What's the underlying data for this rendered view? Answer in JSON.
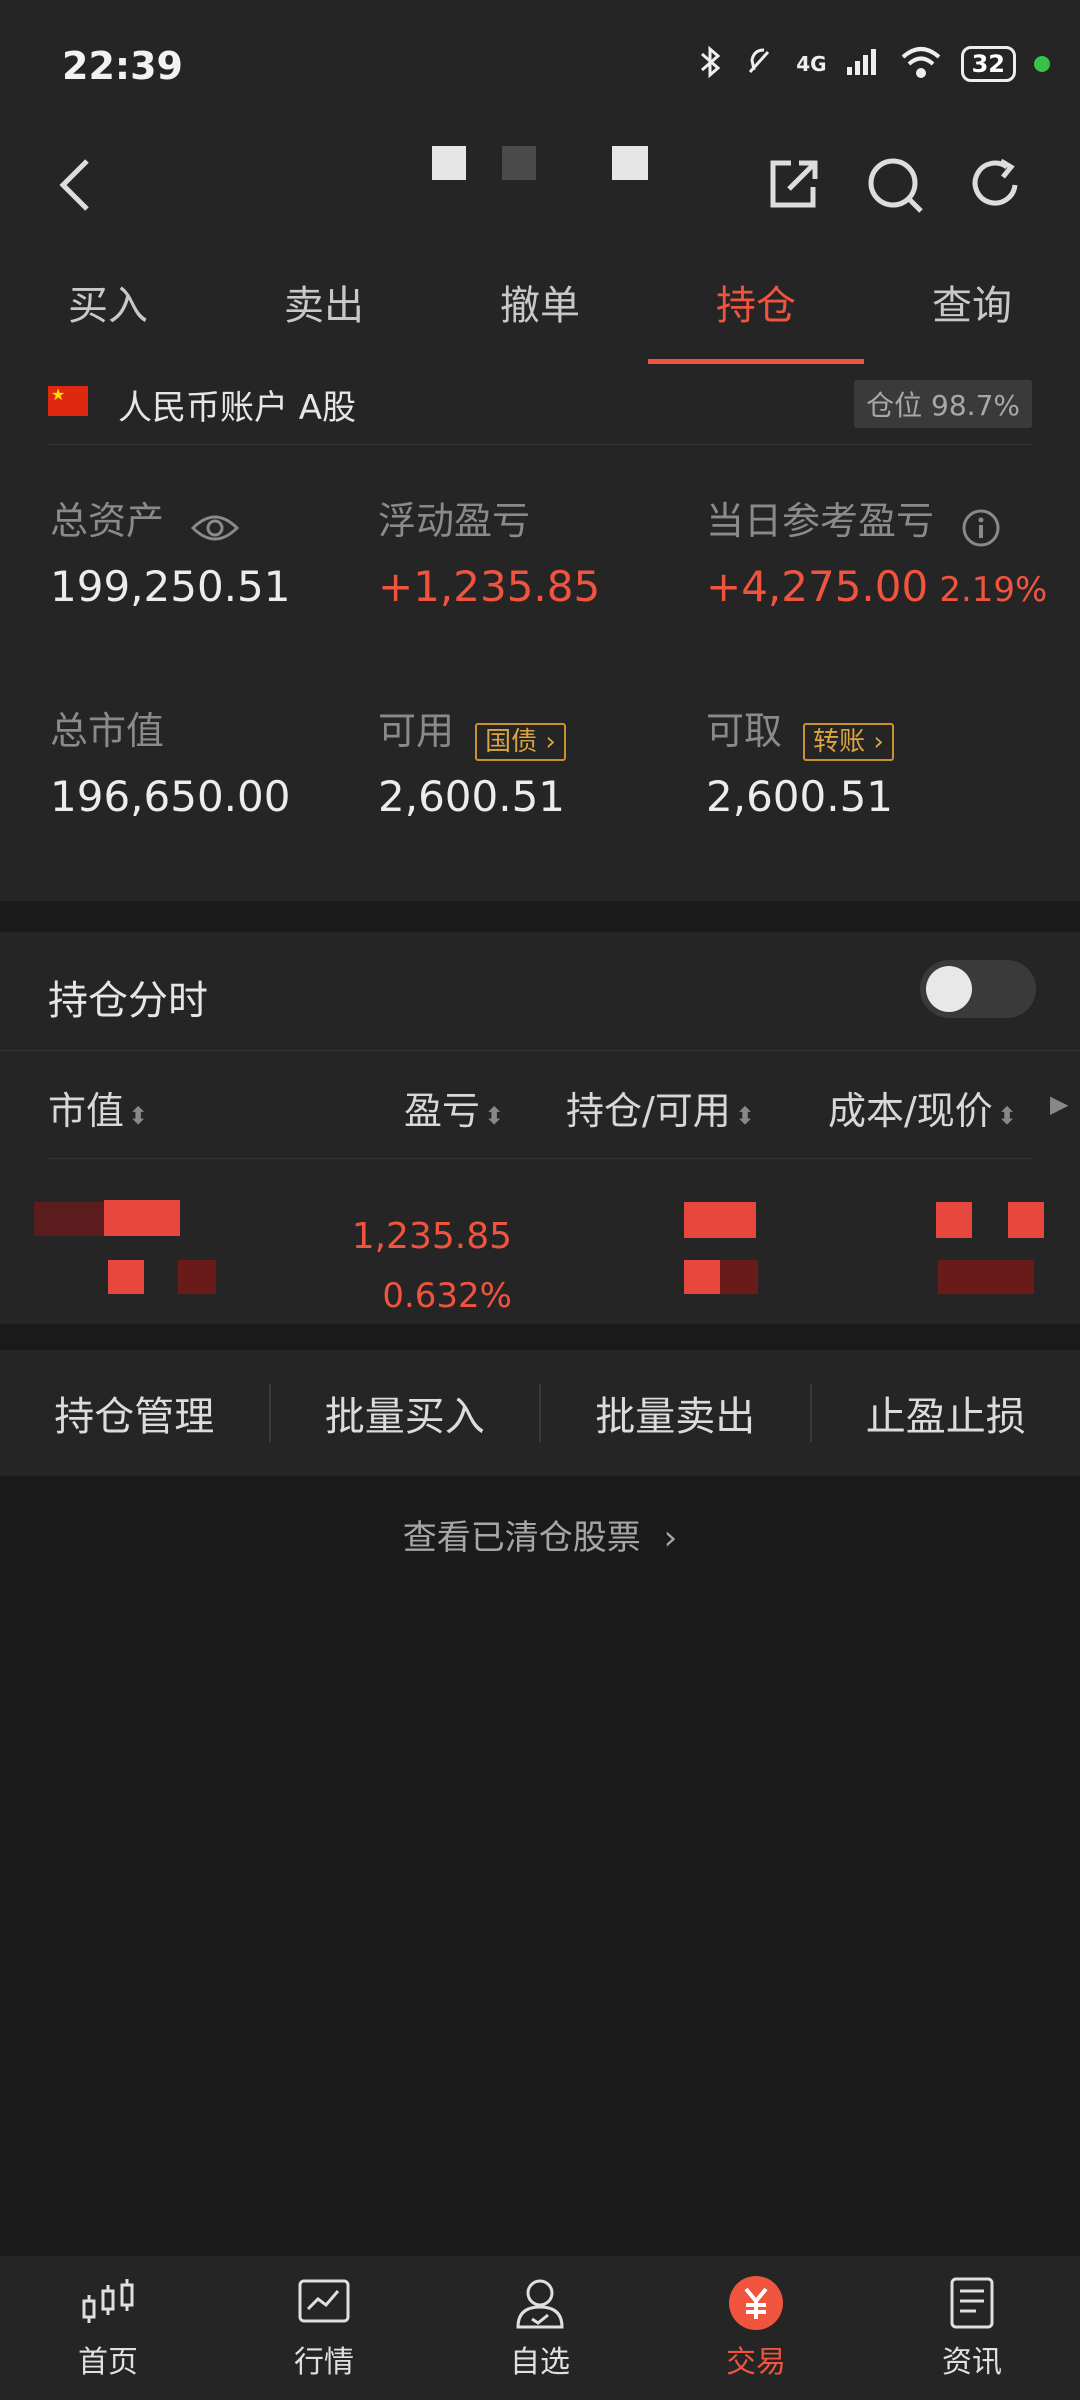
{
  "status_bar": {
    "time": "22:39",
    "network": "4G",
    "battery": "32"
  },
  "tabs": [
    {
      "label": "买入"
    },
    {
      "label": "卖出"
    },
    {
      "label": "撤单"
    },
    {
      "label": "持仓",
      "active": true
    },
    {
      "label": "查询"
    }
  ],
  "account": {
    "name": "人民币账户 A股",
    "position_ratio": "仓位 98.7%",
    "total_assets_label": "总资产",
    "total_assets": "199,250.51",
    "floating_pl_label": "浮动盈亏",
    "floating_pl": "+1,235.85",
    "daily_pl_label": "当日参考盈亏",
    "daily_pl": "+4,275.00",
    "daily_pl_pct": "2.19%",
    "market_value_label": "总市值",
    "market_value": "196,650.00",
    "available_label": "可用",
    "available_badge": "国债",
    "available": "2,600.51",
    "withdrawable_label": "可取",
    "withdrawable_badge": "转账",
    "withdrawable": "2,600.51"
  },
  "holdings": {
    "intraday_label": "持仓分时",
    "intraday_enabled": false,
    "columns": [
      "市值",
      "盈亏",
      "持仓/可用",
      "成本/现价"
    ],
    "rows": [
      {
        "pl": "1,235.85",
        "pl_pct": "0.632%"
      }
    ]
  },
  "actions": [
    "持仓管理",
    "批量买入",
    "批量卖出",
    "止盈止损"
  ],
  "cleared_link": "查看已清仓股票",
  "bottom_nav": [
    {
      "label": "首页",
      "icon": "candlestick-icon"
    },
    {
      "label": "行情",
      "icon": "chart-line-icon"
    },
    {
      "label": "自选",
      "icon": "user-check-icon"
    },
    {
      "label": "交易",
      "icon": "yuan-icon",
      "active": true
    },
    {
      "label": "资讯",
      "icon": "document-icon"
    }
  ],
  "colors": {
    "accent": "#f0543f",
    "background": "#1a1a1a",
    "card": "#252525",
    "badge_gold": "#d9a441"
  }
}
